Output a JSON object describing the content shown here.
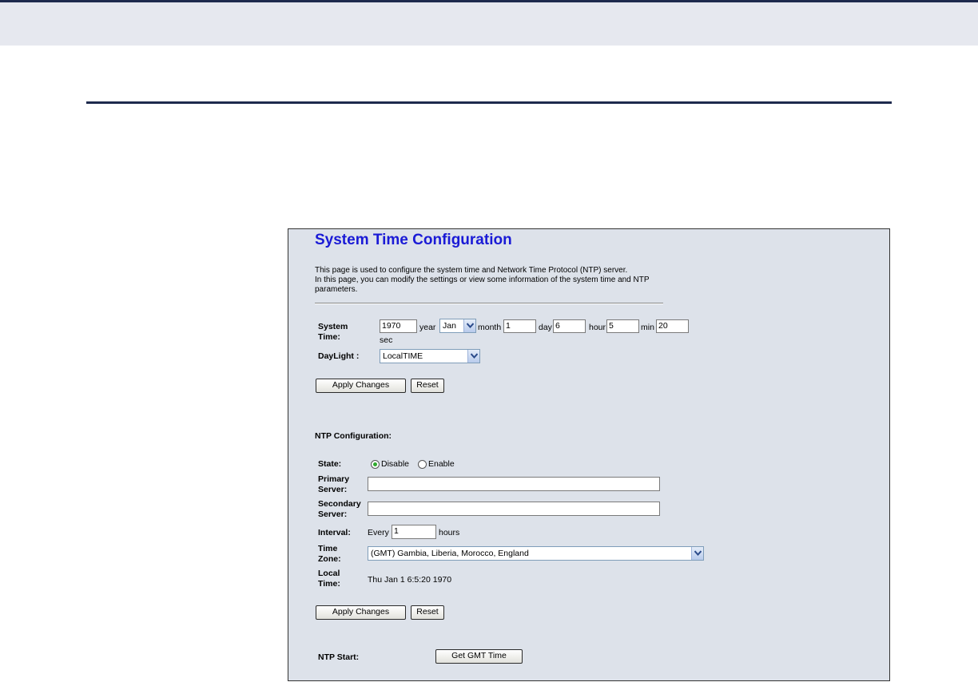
{
  "page": {
    "title": "System Time Configuration",
    "description": [
      "This page is used to configure the system time and Network Time Protocol (NTP) server.",
      "In this page, you can modify the settings or view some information of the system time and NTP",
      "parameters."
    ]
  },
  "system_time": {
    "label_line1": "System",
    "label_line2": "Time:",
    "year": "1970",
    "year_unit": "year",
    "month": "Jan",
    "month_unit": "month",
    "day": "1",
    "day_unit": "day",
    "hour": "6",
    "hour_unit": "hour",
    "min": "5",
    "min_unit": "min",
    "sec": "20",
    "sec_unit": "sec"
  },
  "daylight": {
    "label": "DayLight :",
    "value": "LocalTIME"
  },
  "buttons": {
    "apply": "Apply Changes",
    "reset": "Reset",
    "get_gmt": "Get GMT Time"
  },
  "ntp": {
    "heading": "NTP Configuration:",
    "state_label": "State:",
    "disable_label": "Disable",
    "enable_label": "Enable",
    "state_selected": "Disable",
    "primary_line1": "Primary",
    "primary_line2": "Server:",
    "primary_value": "",
    "secondary_line1": "Secondary",
    "secondary_line2": "Server:",
    "secondary_value": "",
    "interval_label": "Interval:",
    "interval_prefix": "Every",
    "interval_value": "1",
    "interval_unit": "hours",
    "tz_line1": "Time",
    "tz_line2": "Zone:",
    "tz_value": "(GMT) Gambia, Liberia, Morocco, England",
    "local_line1": "Local",
    "local_line2": "Time:",
    "local_value": "Thu Jan 1 6:5:20 1970",
    "start_label": "NTP Start:"
  }
}
